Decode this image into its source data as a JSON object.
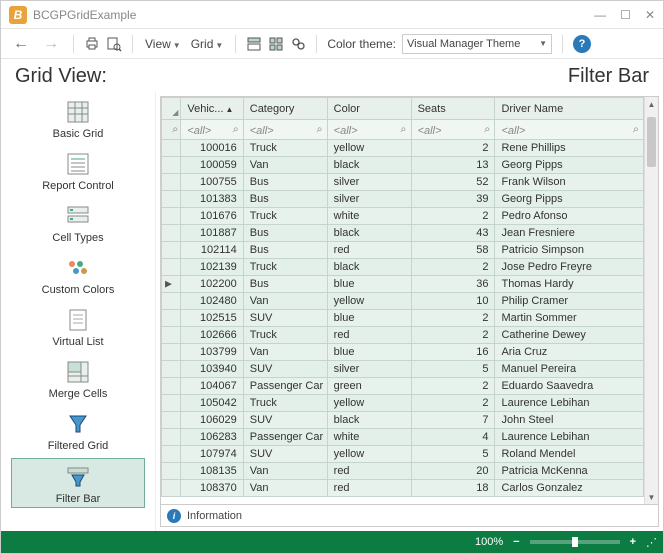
{
  "window": {
    "title": "BCGPGridExample"
  },
  "toolbar": {
    "view_label": "View",
    "grid_label": "Grid",
    "color_theme_label": "Color theme:",
    "theme_value": "Visual Manager Theme"
  },
  "header": {
    "left": "Grid View:",
    "right": "Filter Bar"
  },
  "sidebar": {
    "items": [
      {
        "label": "Basic Grid"
      },
      {
        "label": "Report Control"
      },
      {
        "label": "Cell Types"
      },
      {
        "label": "Custom Colors"
      },
      {
        "label": "Virtual List"
      },
      {
        "label": "Merge Cells"
      },
      {
        "label": "Filtered Grid"
      },
      {
        "label": "Filter Bar"
      }
    ]
  },
  "grid": {
    "columns": {
      "vehicle": "Vehic...",
      "category": "Category",
      "color": "Color",
      "seats": "Seats",
      "driver": "Driver Name"
    },
    "filter_placeholder": "<all>",
    "rows": [
      {
        "id": "100016",
        "cat": "Truck",
        "color": "yellow",
        "seats": "2",
        "driver": "Rene Phillips"
      },
      {
        "id": "100059",
        "cat": "Van",
        "color": "black",
        "seats": "13",
        "driver": "Georg Pipps"
      },
      {
        "id": "100755",
        "cat": "Bus",
        "color": "silver",
        "seats": "52",
        "driver": "Frank Wilson"
      },
      {
        "id": "101383",
        "cat": "Bus",
        "color": "silver",
        "seats": "39",
        "driver": "Georg Pipps"
      },
      {
        "id": "101676",
        "cat": "Truck",
        "color": "white",
        "seats": "2",
        "driver": "Pedro Afonso"
      },
      {
        "id": "101887",
        "cat": "Bus",
        "color": "black",
        "seats": "43",
        "driver": "Jean Fresniere"
      },
      {
        "id": "102114",
        "cat": "Bus",
        "color": "red",
        "seats": "58",
        "driver": "Patricio Simpson"
      },
      {
        "id": "102139",
        "cat": "Truck",
        "color": "black",
        "seats": "2",
        "driver": "Jose Pedro Freyre"
      },
      {
        "id": "102200",
        "cat": "Bus",
        "color": "blue",
        "seats": "36",
        "driver": "Thomas Hardy",
        "marker": true
      },
      {
        "id": "102480",
        "cat": "Van",
        "color": "yellow",
        "seats": "10",
        "driver": "Philip Cramer"
      },
      {
        "id": "102515",
        "cat": "SUV",
        "color": "blue",
        "seats": "2",
        "driver": "Martin Sommer"
      },
      {
        "id": "102666",
        "cat": "Truck",
        "color": "red",
        "seats": "2",
        "driver": "Catherine Dewey"
      },
      {
        "id": "103799",
        "cat": "Van",
        "color": "blue",
        "seats": "16",
        "driver": "Aria Cruz"
      },
      {
        "id": "103940",
        "cat": "SUV",
        "color": "silver",
        "seats": "5",
        "driver": "Manuel Pereira"
      },
      {
        "id": "104067",
        "cat": "Passenger Car",
        "color": "green",
        "seats": "2",
        "driver": "Eduardo Saavedra"
      },
      {
        "id": "105042",
        "cat": "Truck",
        "color": "yellow",
        "seats": "2",
        "driver": "Laurence Lebihan"
      },
      {
        "id": "106029",
        "cat": "SUV",
        "color": "black",
        "seats": "7",
        "driver": "John Steel"
      },
      {
        "id": "106283",
        "cat": "Passenger Car",
        "color": "white",
        "seats": "4",
        "driver": "Laurence Lebihan"
      },
      {
        "id": "107974",
        "cat": "SUV",
        "color": "yellow",
        "seats": "5",
        "driver": "Roland Mendel"
      },
      {
        "id": "108135",
        "cat": "Van",
        "color": "red",
        "seats": "20",
        "driver": "Patricia McKenna"
      },
      {
        "id": "108370",
        "cat": "Van",
        "color": "red",
        "seats": "18",
        "driver": "Carlos Gonzalez"
      }
    ]
  },
  "info": {
    "label": "Information"
  },
  "status": {
    "zoom": "100%"
  }
}
